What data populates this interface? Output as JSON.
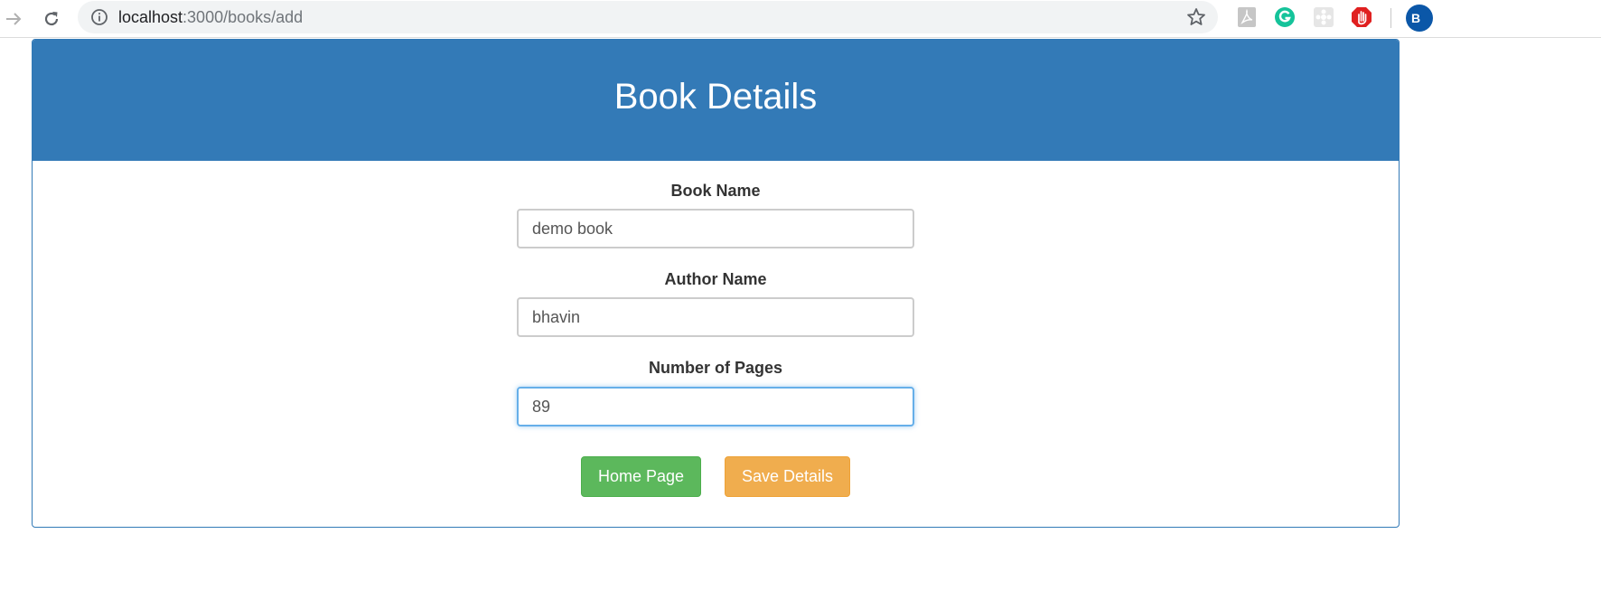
{
  "browser": {
    "url_host": "localhost",
    "url_path": ":3000/books/add",
    "profile_initial": "B"
  },
  "panel": {
    "title": "Book Details"
  },
  "form": {
    "book_name_label": "Book Name",
    "book_name_value": "demo book",
    "author_name_label": "Author Name",
    "author_name_value": "bhavin",
    "pages_label": "Number of Pages",
    "pages_value": "89"
  },
  "buttons": {
    "home_label": "Home Page",
    "save_label": "Save Details"
  },
  "colors": {
    "primary": "#337ab7",
    "success": "#5cb85c",
    "warning": "#f0ad4e",
    "focus": "#66afe9"
  }
}
